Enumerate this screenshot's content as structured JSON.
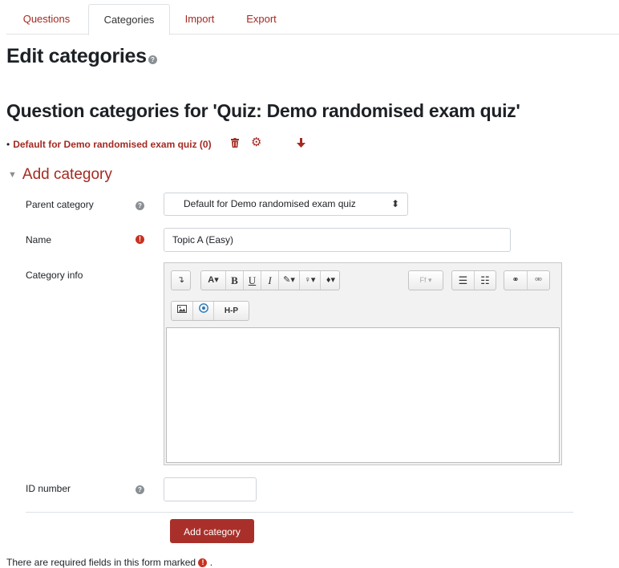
{
  "tabs": [
    {
      "label": "Questions",
      "active": false
    },
    {
      "label": "Categories",
      "active": true
    },
    {
      "label": "Import",
      "active": false
    },
    {
      "label": "Export",
      "active": false
    }
  ],
  "page_title": "Edit categories",
  "subtitle": "Question categories for 'Quiz: Demo randomised exam quiz'",
  "category_list": [
    {
      "label": "Default for Demo randomised exam quiz (0)",
      "actions": [
        "trash-icon",
        "gear-icon",
        "arrow-down-icon"
      ]
    }
  ],
  "add_category": {
    "section_title": "Add category",
    "fields": {
      "parent": {
        "label": "Parent category",
        "value": "Default for Demo randomised exam quiz"
      },
      "name": {
        "label": "Name",
        "value": "Topic A (Easy)",
        "required": true
      },
      "info": {
        "label": "Category info",
        "value": ""
      },
      "idnumber": {
        "label": "ID number",
        "value": ""
      }
    },
    "editor_toolbar": {
      "row1": [
        "↴",
        "A▾",
        "B",
        "U",
        "I",
        "✎▾",
        "♀▾",
        "♦▾",
        "Ff▾",
        "☰",
        "☷",
        "⚭",
        "⚮"
      ],
      "row2": [
        "🖼",
        "ⓘ",
        "H-P"
      ]
    },
    "submit_label": "Add category"
  },
  "required_note": "There are required fields in this form marked",
  "required_note_end": ".",
  "colors": {
    "brand": "#a42a21",
    "button": "#a9302a",
    "required": "#ca3120"
  }
}
